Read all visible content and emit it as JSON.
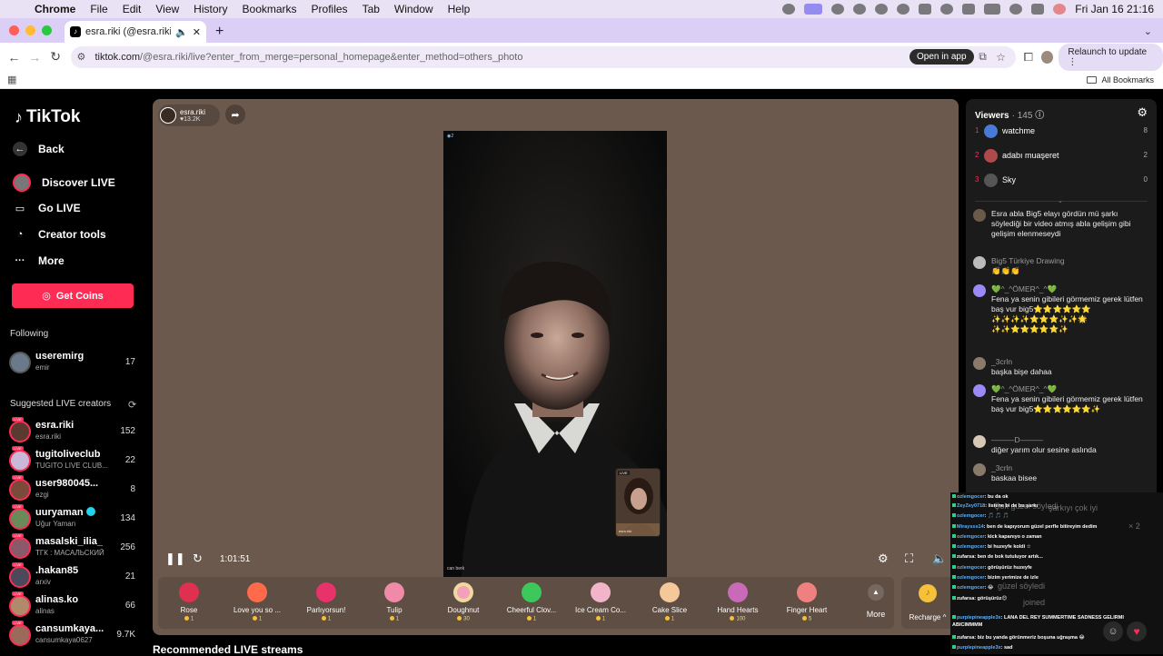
{
  "menubar": {
    "app": "Chrome",
    "items": [
      "File",
      "Edit",
      "View",
      "History",
      "Bookmarks",
      "Profiles",
      "Tab",
      "Window",
      "Help"
    ],
    "datetime": "Fri Jan 16  21:16"
  },
  "tab": {
    "title": "esra.riki (@esra.riki) is LIVE"
  },
  "toolbar": {
    "url_host": "tiktok.com",
    "url_path": "/@esra.riki/live?enter_from_merge=personal_homepage&enter_method=others_photo",
    "open_in_app": "Open in app",
    "relaunch": "Relaunch to update"
  },
  "bookmarks": {
    "all": "All Bookmarks"
  },
  "sidebar": {
    "logo": "TikTok",
    "nav": [
      {
        "label": "Back",
        "icon": "arrow-left-icon"
      },
      {
        "label": "Discover LIVE",
        "icon": "live-avatar-icon"
      },
      {
        "label": "Go LIVE",
        "icon": "video-camera-icon"
      },
      {
        "label": "Creator tools",
        "icon": "lightbulb-icon"
      },
      {
        "label": "More",
        "icon": "ellipsis-icon"
      }
    ],
    "get_coins": "Get Coins",
    "following_label": "Following",
    "following": [
      {
        "name": "useremirg",
        "sub": "emir",
        "count": "17",
        "color": "#6b7a8a"
      }
    ],
    "suggested_label": "Suggested LIVE creators",
    "suggested": [
      {
        "name": "esra.riki",
        "sub": "esra.riki",
        "count": "152",
        "color": "#5a3a30"
      },
      {
        "name": "tugitoliveclub",
        "sub": "TUGITO LIVE CLUB...",
        "count": "22",
        "color": "#c9b8d8"
      },
      {
        "name": "user980045...",
        "sub": "ezgi",
        "count": "8",
        "color": "#7a4a3a"
      },
      {
        "name": "uuryaman",
        "sub": "Uğur Yaman",
        "count": "134",
        "color": "#6a8a5a",
        "verified": true
      },
      {
        "name": "masalski_ilia_",
        "sub": "ТГК : МАСАЛЬСКИЙ",
        "count": "256",
        "color": "#8a5a6a"
      },
      {
        "name": ".hakan85",
        "sub": "arxiv",
        "count": "21",
        "color": "#4a4a5a"
      },
      {
        "name": "alinas.ko",
        "sub": "alinas",
        "count": "66",
        "color": "#b08a6a"
      },
      {
        "name": "cansumkaya...",
        "sub": "cansumkaya0627",
        "count": "9.7K",
        "color": "#9a6a5a"
      }
    ]
  },
  "player": {
    "host_name": "esra.riki",
    "host_likes": "13.2K",
    "camera_label": "2",
    "bottom_name": "can berk",
    "pip_tag": "LIVE",
    "pip_name": "esra.riki",
    "time": "1:01:51"
  },
  "gifts": [
    {
      "name": "Rose",
      "price": "1",
      "color": "#e03050"
    },
    {
      "name": "Love you so ...",
      "price": "1",
      "color": "#ff6a4a"
    },
    {
      "name": "Parlıyorsun!",
      "price": "1",
      "color": "#e8326a"
    },
    {
      "name": "Tulip",
      "price": "1",
      "color": "#f08aa8"
    },
    {
      "name": "Doughnut",
      "price": "30",
      "color": "#f4a0b8"
    },
    {
      "name": "Cheerful Clov...",
      "price": "1",
      "color": "#3cc85a"
    },
    {
      "name": "Ice Cream Co...",
      "price": "1",
      "color": "#f2b4c8"
    },
    {
      "name": "Cake Slice",
      "price": "1",
      "color": "#f5c89a"
    },
    {
      "name": "Hand Hearts",
      "price": "100",
      "color": "#c86ab8"
    },
    {
      "name": "Finger Heart",
      "price": "5",
      "color": "#f08080"
    }
  ],
  "gift_more": "More",
  "recharge": "Recharge",
  "recommended": "Recommended LIVE streams",
  "viewers": {
    "title": "Viewers",
    "count": "· 145",
    "list": [
      {
        "rank": "1",
        "name": "watchme",
        "score": "8",
        "color": "#4a7ad8"
      },
      {
        "rank": "2",
        "name": "adabı muaşeret",
        "score": "2",
        "color": "#b04a4a"
      },
      {
        "rank": "3",
        "name": "Sky",
        "score": "0",
        "color": "#555"
      }
    ]
  },
  "chat": [
    {
      "user": "",
      "msg": "Esra abla Big5 elayı gördün mü şarkı söylediği bir video atmış abla gelişim gibi gelişim elenmeseydi",
      "color": "#6a5a4a"
    },
    {
      "user": "Big5 Türkiye Drawing",
      "msg": "👏👏👏",
      "color": "#bbb"
    },
    {
      "user": "💚^_^ÖMER^_^💚",
      "msg": "Fena ya senin gibileri görmemiz gerek lütfen baş vur big5⭐⭐⭐⭐⭐⭐ ✨✨✨✨⭐⭐⭐✨✨🌟 ✨✨⭐⭐⭐⭐⭐✨",
      "color": "#9a8af8"
    },
    {
      "user": "_3crln",
      "msg": "başka bişe dahaa",
      "color": "#8a7a6a"
    },
    {
      "user": "💚^_^ÖMER^_^💚",
      "msg": "Fena ya senin gibileri görmemiz gerek lütfen baş vur big5⭐⭐⭐⭐⭐⭐✨",
      "color": "#9a8af8"
    },
    {
      "user": "———D———",
      "msg": "diğer yarım olur sesine aslında",
      "color": "#d8c8b8"
    },
    {
      "user": "_3crln",
      "msg": "baskaa bisee",
      "color": "#8a7a6a"
    }
  ],
  "overlay": {
    "lines": [
      {
        "user": "ozlemgocer",
        "msg": ": bu da ok"
      },
      {
        "user": "ZeyZey0718",
        "msg": ": listene bi de bu şarkı"
      },
      {
        "user": "ozlemgocer",
        "msg": ": 🎵 🎵 🎵"
      },
      {
        "user": "Miraysss14",
        "msg": ": ben de kapıyorum güzel perfle bitireyim dedim"
      },
      {
        "user": "ozlemgocer",
        "msg": ": kick kapanıyo o zaman"
      },
      {
        "user": "ozlemgocer",
        "msg": ": bi huzeyfe koldi ☆"
      },
      {
        "user": "zufarsa",
        "msg": ": ben de bok tutuluyor artık..."
      },
      {
        "user": "ozlemgocer",
        "msg": ": görüşürüz huzeyfe"
      },
      {
        "user": "ozlemgocer",
        "msg": ": bizim yerimize de izle"
      },
      {
        "user": "ozlemgocer",
        "msg": ": 😂"
      },
      {
        "user": "zufarsa",
        "msg": ": görüşürüz😊"
      },
      {
        "user": "purplepineapple3x",
        "msg": ": LANA DEL REY SUMMERTIME SADNESS GELIRMI ABICIMMMM"
      },
      {
        "user": "zufarsa",
        "msg": ": biz bu yanda görünmeriz boşuna uğraşma 😂"
      },
      {
        "user": "purplepineapple3x",
        "msg": ": sad"
      }
    ],
    "ghost_1": "Çok güzel söyledi",
    "ghost_2": "şarkıyı çok iyi",
    "ghost_3": "güzel söyledi",
    "ghost_4": "joined",
    "ghost_x": "× 2"
  }
}
